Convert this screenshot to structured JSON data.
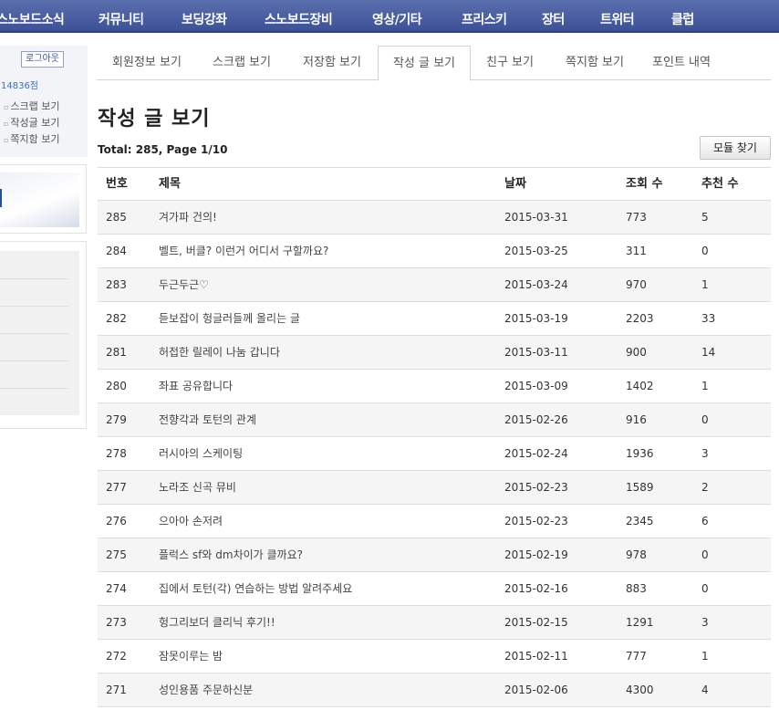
{
  "topnav": {
    "items": [
      "스노보드소식",
      "커뮤니티",
      "보딩강좌",
      "스노보드장비",
      "영상/기타",
      "프리스키",
      "장터",
      "트위터",
      "클럽"
    ]
  },
  "sidebar": {
    "logout_label": "로그아웃",
    "points": "14836점",
    "links": [
      "스크랩 보기",
      "작성글 보기",
      "쪽지함 보기"
    ]
  },
  "tabs": [
    "회원정보 보기",
    "스크랩 보기",
    "저장함 보기",
    "작성 글 보기",
    "친구 보기",
    "쪽지함 보기",
    "포인트 내역"
  ],
  "active_tab": 3,
  "page": {
    "title": "작성 글 보기",
    "summary": "Total: 285, Page 1/10",
    "module_button": "모듈 찾기"
  },
  "table": {
    "headers": {
      "no": "번호",
      "title": "제목",
      "date": "날짜",
      "views": "조회 수",
      "rec": "추천 수"
    },
    "rows": [
      {
        "no": "285",
        "title": "겨가파 건의!",
        "date": "2015-03-31",
        "views": "773",
        "rec": "5"
      },
      {
        "no": "284",
        "title": "벨트, 버클? 이런거 어디서 구할까요?",
        "date": "2015-03-25",
        "views": "311",
        "rec": "0"
      },
      {
        "no": "283",
        "title": "두근두근♡",
        "date": "2015-03-24",
        "views": "970",
        "rec": "1"
      },
      {
        "no": "282",
        "title": "듣보잡이 헝글러들께 올리는 글",
        "date": "2015-03-19",
        "views": "2203",
        "rec": "33"
      },
      {
        "no": "281",
        "title": "허접한 릴레이 나눔 갑니다",
        "date": "2015-03-11",
        "views": "900",
        "rec": "14"
      },
      {
        "no": "280",
        "title": "좌표 공유합니다",
        "date": "2015-03-09",
        "views": "1402",
        "rec": "1"
      },
      {
        "no": "279",
        "title": "전향각과 토턴의 관계",
        "date": "2015-02-26",
        "views": "916",
        "rec": "0"
      },
      {
        "no": "278",
        "title": "러시아의 스케이팅",
        "date": "2015-02-24",
        "views": "1936",
        "rec": "3"
      },
      {
        "no": "277",
        "title": "노라조 신곡 뮤비",
        "date": "2015-02-23",
        "views": "1589",
        "rec": "2"
      },
      {
        "no": "276",
        "title": "으아아 손저려",
        "date": "2015-02-23",
        "views": "2345",
        "rec": "6"
      },
      {
        "no": "275",
        "title": "플럭스 sf와 dm차이가 클까요?",
        "date": "2015-02-19",
        "views": "978",
        "rec": "0"
      },
      {
        "no": "274",
        "title": "집에서 토턴(각) 연습하는 방법 알려주세요",
        "date": "2015-02-16",
        "views": "883",
        "rec": "0"
      },
      {
        "no": "273",
        "title": "헝그리보더 클리닉 후기!!",
        "date": "2015-02-15",
        "views": "1291",
        "rec": "3"
      },
      {
        "no": "272",
        "title": "잠못이루는 밤",
        "date": "2015-02-11",
        "views": "777",
        "rec": "1"
      },
      {
        "no": "271",
        "title": "성인용품 주문하신분",
        "date": "2015-02-06",
        "views": "4300",
        "rec": "4"
      }
    ]
  }
}
